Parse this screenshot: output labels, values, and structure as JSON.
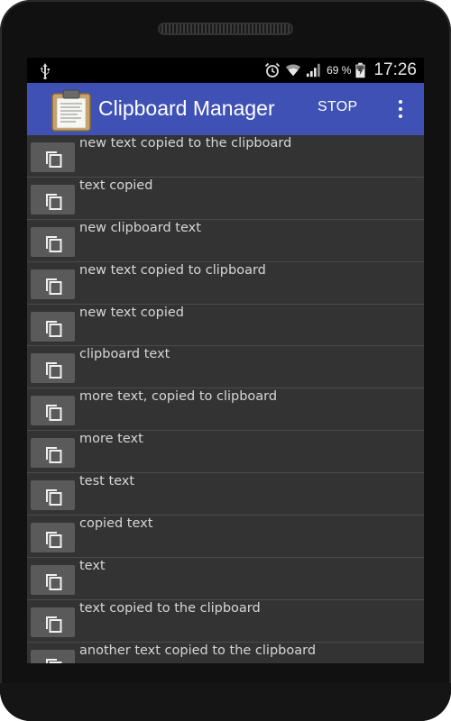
{
  "status_bar": {
    "icons": [
      "usb-icon",
      "alarm-icon",
      "wifi-icon",
      "signal-icon",
      "battery-charging-icon"
    ],
    "battery_percent": "69 %",
    "time": "17:26"
  },
  "action_bar": {
    "app_icon": "clipboard-icon",
    "title": "Clipboard Manager",
    "stop_label": "STOP",
    "overflow_icon": "more-vert-icon",
    "color": "#3f51b5"
  },
  "clips": [
    {
      "text": "new text copied to the clipboard"
    },
    {
      "text": "text copied"
    },
    {
      "text": "new clipboard text"
    },
    {
      "text": "new text copied to clipboard"
    },
    {
      "text": "new text copied"
    },
    {
      "text": "clipboard text"
    },
    {
      "text": "more text, copied to clipboard"
    },
    {
      "text": "more text"
    },
    {
      "text": "test text"
    },
    {
      "text": "copied text"
    },
    {
      "text": "text"
    },
    {
      "text": "text copied to the clipboard"
    },
    {
      "text": "another text copied to the clipboard"
    }
  ]
}
